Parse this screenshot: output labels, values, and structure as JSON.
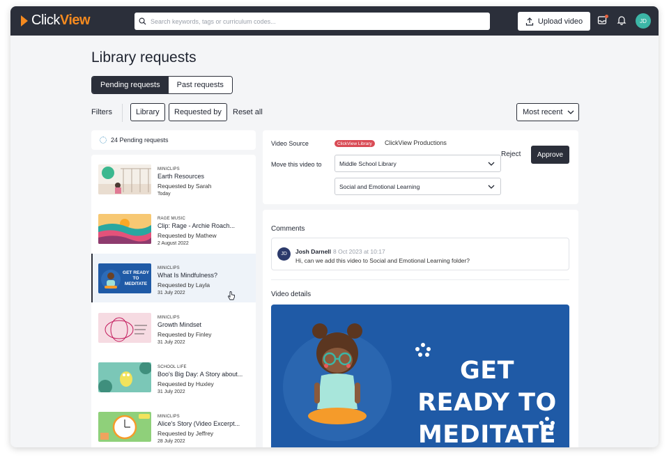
{
  "app": {
    "logo_click": "Click",
    "logo_view": "View",
    "search_placeholder": "Search keywords, tags or curriculum codes...",
    "upload_label": "Upload video",
    "user_initials": "JD"
  },
  "page": {
    "title": "Library requests",
    "tabs": [
      {
        "label": "Pending requests",
        "active": true
      },
      {
        "label": "Past requests",
        "active": false
      }
    ],
    "filters_label": "Filters",
    "filter_library": "Library",
    "filter_requested_by": "Requested by",
    "reset_label": "Reset all",
    "sort_label": "Most recent"
  },
  "list": {
    "pending_count": "24 Pending requests",
    "items": [
      {
        "category": "MINICLIPS",
        "title": "Earth Resources",
        "requested_by": "Requested by Sarah",
        "date": "Today"
      },
      {
        "category": "RAGE MUSIC",
        "title": "Clip: Rage - Archie Roach...",
        "requested_by": "Requested by Mathew",
        "date": "2 August 2022"
      },
      {
        "category": "MINICLIPS",
        "title": "What Is Mindfulness?",
        "requested_by": "Requested by Layla",
        "date": "31 July 2022",
        "thumb_text": "GET READY TO MEDITATE"
      },
      {
        "category": "MINICLIPS",
        "title": "Growth Mindset",
        "requested_by": "Requested by Finley",
        "date": "31 July 2022"
      },
      {
        "category": "SCHOOL LIFE",
        "title": "Boo's Big Day: A Story about...",
        "requested_by": "Requested by Huxley",
        "date": "31 July 2022"
      },
      {
        "category": "MINICLIPS",
        "title": "Alice's Story (Video Excerpt...",
        "requested_by": "Requested by Jeffrey",
        "date": "28 July 2022"
      }
    ]
  },
  "detail": {
    "video_source_label": "Video Source",
    "source_badge": "ClickView Library",
    "source_name": "ClickView Productions",
    "move_label": "Move this video to",
    "library_select": "Middle School Library",
    "folder_select": "Social and Emotional Learning",
    "reject_label": "Reject",
    "approve_label": "Approve",
    "comments_title": "Comments",
    "comment": {
      "initials": "JD",
      "author": "Josh Darnell",
      "time": "8 Oct 2023 at 10:17",
      "text": "Hi, can we add this video to Social and Emotional Learning folder?"
    },
    "video_details_title": "Video details",
    "video_line1": "GET READY TO",
    "video_line2": "MEDITATE"
  },
  "colors": {
    "topbar": "#2b2f3a",
    "accent_orange": "#f58a1f",
    "badge_red": "#d94b55",
    "avatar_teal": "#3cb6a6",
    "video_blue": "#1f5aa6"
  }
}
